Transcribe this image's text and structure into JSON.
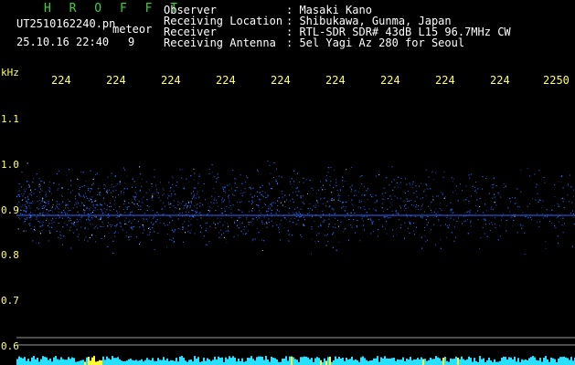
{
  "header": {
    "app_title": "H R O F F T",
    "filename": "UT2510162240.pn",
    "suffix": "meteor",
    "datetime": "25.10.16 22:40",
    "count": "9",
    "fields": [
      {
        "label": "Observer",
        "value": ": Masaki Kano"
      },
      {
        "label": "Receiving Location",
        "value": ": Shibukawa, Gunma, Japan"
      },
      {
        "label": "Receiver",
        "value": ": RTL-SDR SDR# 43dB L15 96.7MHz CW"
      },
      {
        "label": "Receiving Antenna",
        "value": ": 5el Yagi Az 280 for Seoul"
      }
    ]
  },
  "axes": {
    "y_unit": "kHz",
    "y_ticks": [
      "1.1",
      "1.0",
      "0.9",
      "0.8",
      "0.7",
      "0.6"
    ],
    "x_ticks": [
      "224",
      "224",
      "224",
      "224",
      "224",
      "224",
      "224",
      "224",
      "224",
      "2250"
    ]
  },
  "colors": {
    "background": "#000000",
    "signal": "#2a6cff",
    "signal_bright": "#9fd0ff",
    "grid": "#9a9a9a",
    "tick_text": "#ffff66",
    "title": "#3ad33a",
    "level_bar": "#28e0ff",
    "level_peak": "#ffff33"
  }
}
